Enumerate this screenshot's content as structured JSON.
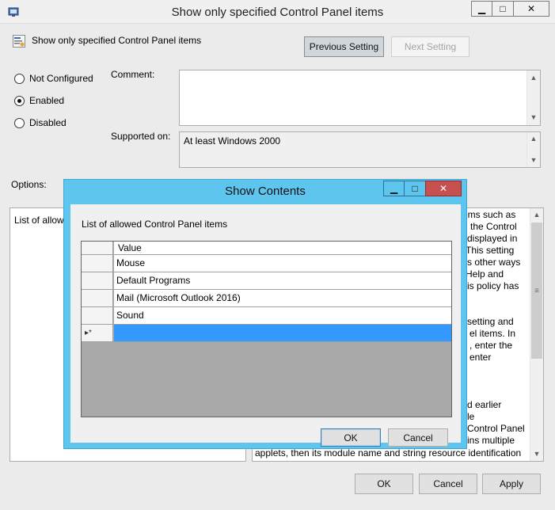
{
  "window": {
    "title": "Show only specified Control Panel items",
    "minimize_glyph": "▁",
    "maximize_glyph": "□",
    "close_glyph": "✕"
  },
  "header": {
    "setting_name": "Show only specified Control Panel items",
    "previous_label": "Previous Setting",
    "next_label": "Next Setting"
  },
  "state": {
    "options": [
      {
        "label": "Not Configured",
        "selected": false
      },
      {
        "label": "Enabled",
        "selected": true
      },
      {
        "label": "Disabled",
        "selected": false
      }
    ]
  },
  "labels": {
    "comment": "Comment:",
    "supported_on": "Supported on:",
    "options": "Options:"
  },
  "supported_on_value": "At least Windows 2000",
  "options_panel": {
    "list_label": "List of allowed"
  },
  "help_lines": [
    {
      "text": "ems such as"
    },
    {
      "text": "n the Control"
    },
    {
      "text": "displayed in"
    },
    {
      "text": "This setting"
    },
    {
      "text": "s other ways"
    },
    {
      "text": "Help and"
    },
    {
      "text": "is policy has"
    },
    {
      "text": "setting and"
    },
    {
      "text": "el items. In"
    },
    {
      "text": ", enter the"
    },
    {
      "text": "enter"
    },
    {
      "text": "d earlier"
    },
    {
      "text": "le"
    },
    {
      "text": "Control Panel"
    },
    {
      "text": "ins multiple"
    }
  ],
  "help_bottom_line": "applets, then its module name and string resource identification",
  "footer": {
    "ok": "OK",
    "cancel": "Cancel",
    "apply": "Apply"
  },
  "dialog": {
    "title": "Show Contents",
    "minimize_glyph": "▁",
    "maximize_glyph": "□",
    "close_glyph": "✕",
    "list_caption": "List of allowed Control Panel items",
    "column_header": "Value",
    "rows": [
      {
        "value": "Mouse"
      },
      {
        "value": "Default Programs"
      },
      {
        "value": "Mail (Microsoft Outlook 2016)"
      },
      {
        "value": "Sound"
      }
    ],
    "new_row_marker": "▸*",
    "ok": "OK",
    "cancel": "Cancel"
  },
  "colors": {
    "dialog_frame": "#5ec5ee",
    "close_button": "#c75050",
    "selection": "#3399ff"
  }
}
